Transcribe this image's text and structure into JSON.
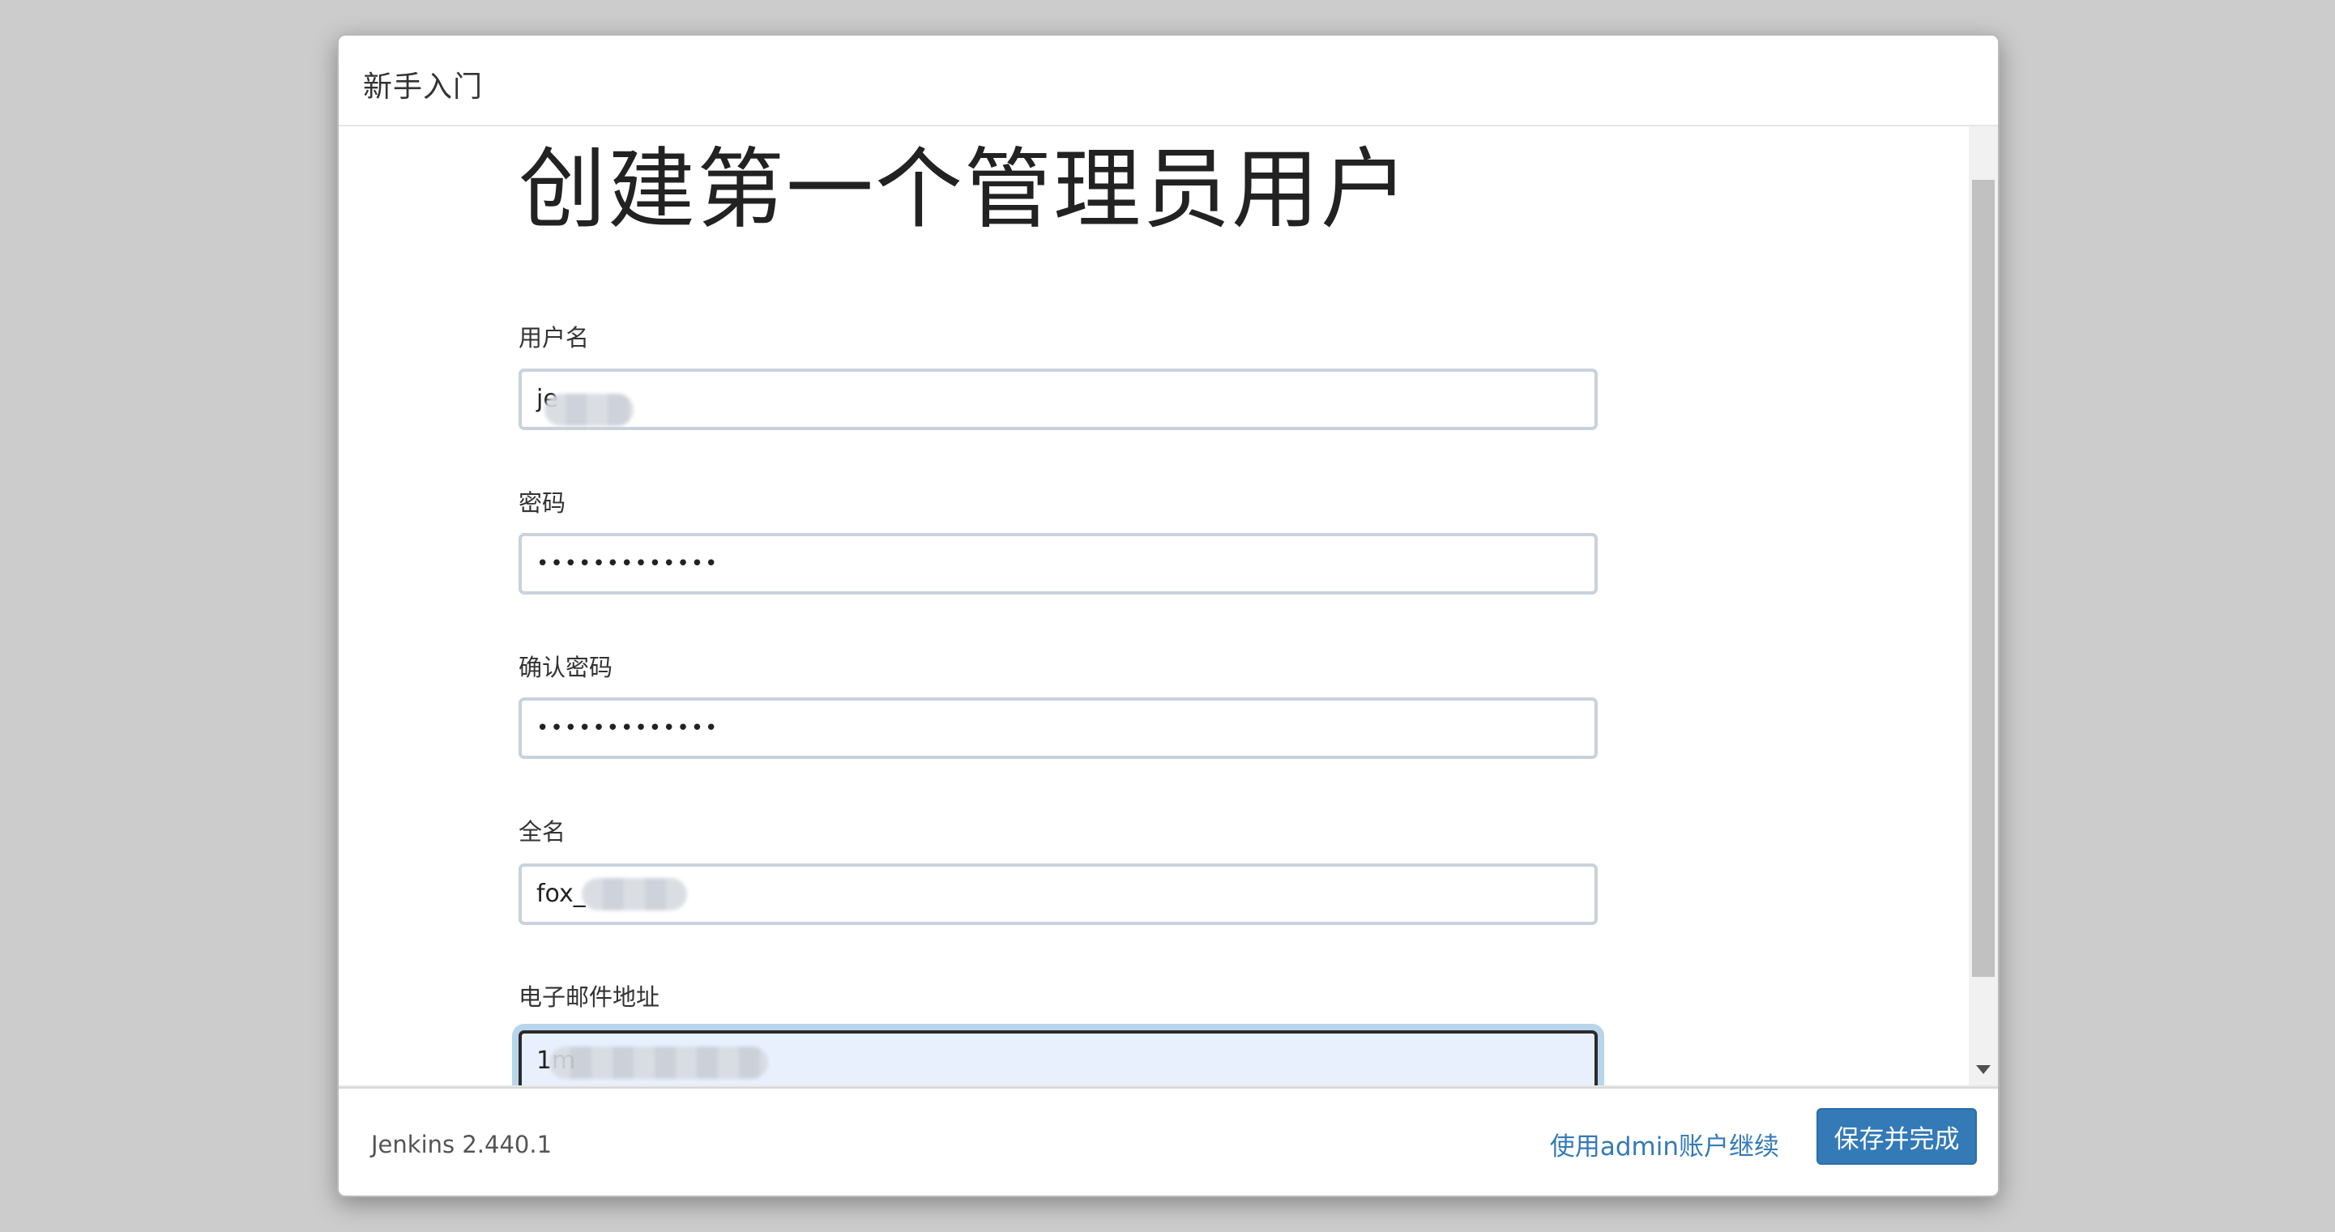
{
  "dialog": {
    "title": "新手入门"
  },
  "form": {
    "heading": "创建第一个管理员用户",
    "fields": [
      {
        "label": "用户名",
        "value": "je",
        "type": "text"
      },
      {
        "label": "密码",
        "value": "•••••••••••••",
        "type": "password"
      },
      {
        "label": "确认密码",
        "value": "•••••••••••••",
        "type": "password"
      },
      {
        "label": "全名",
        "value": "fox_",
        "type": "text"
      },
      {
        "label": "电子邮件地址",
        "value": "1m",
        "type": "text",
        "focused": true
      }
    ]
  },
  "footer": {
    "version": "Jenkins 2.440.1",
    "continue_link": "使用admin账户继续",
    "save_button": "保存并完成"
  },
  "colors": {
    "primary": "#337ab7",
    "input_border": "#c9d2dc",
    "focus_bg": "#e8f0fe",
    "backdrop": "#cccccc"
  },
  "icons": {
    "scroll_down": "triangle-down-icon"
  }
}
